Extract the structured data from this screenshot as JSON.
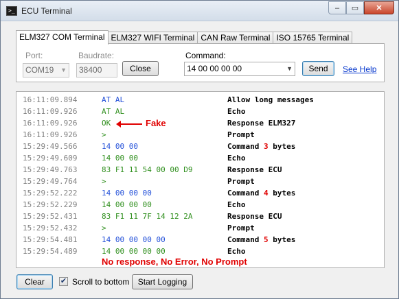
{
  "window": {
    "title": "ECU Terminal",
    "icon": "console-icon",
    "minimize_glyph": "–",
    "maximize_glyph": "▭",
    "close_glyph": "✕"
  },
  "tabs": [
    {
      "label": "ELM327 COM Terminal",
      "active": true
    },
    {
      "label": "ELM327 WIFI Terminal",
      "active": false
    },
    {
      "label": "CAN Raw Terminal",
      "active": false
    },
    {
      "label": "ISO 15765 Terminal",
      "active": false
    }
  ],
  "connection": {
    "port_label": "Port:",
    "port_value": "COM19",
    "baud_label": "Baudrate:",
    "baud_value": "38400",
    "close_button": "Close"
  },
  "command": {
    "label": "Command:",
    "value": "14 00 00 00 00",
    "send_button": "Send",
    "help_link": "See Help"
  },
  "log": {
    "rows": [
      {
        "time": "16:11:09.894",
        "message": "AT AL",
        "message_color": "blue",
        "description": "Allow long messages"
      },
      {
        "time": "16:11:09.926",
        "message": "AT AL",
        "message_color": "green",
        "description": "Echo"
      },
      {
        "time": "16:11:09.926",
        "message": "OK",
        "message_color": "green",
        "description": "Response ELM327"
      },
      {
        "time": "16:11:09.926",
        "message": ">",
        "message_color": "green",
        "description": "Prompt"
      },
      {
        "time": "15:29:49.566",
        "message": "14 00 00",
        "message_color": "blue",
        "description_pre": "Command ",
        "description_num": "3",
        "description_post": " bytes"
      },
      {
        "time": "15:29:49.609",
        "message": "14 00 00",
        "message_color": "green",
        "description": "Echo"
      },
      {
        "time": "15:29:49.763",
        "message": "83 F1 11 54 00 00 D9",
        "message_color": "green",
        "description": "Response ECU"
      },
      {
        "time": "15:29:49.764",
        "message": ">",
        "message_color": "green",
        "description": "Prompt"
      },
      {
        "time": "15:29:52.222",
        "message": "14 00 00 00",
        "message_color": "blue",
        "description_pre": "Command ",
        "description_num": "4",
        "description_post": " bytes"
      },
      {
        "time": "15:29:52.229",
        "message": "14 00 00 00",
        "message_color": "green",
        "description": "Echo"
      },
      {
        "time": "15:29:52.431",
        "message": "83 F1 11 7F 14 12 2A",
        "message_color": "green",
        "description": "Response ECU"
      },
      {
        "time": "15:29:52.432",
        "message": ">",
        "message_color": "green",
        "description": "Prompt"
      },
      {
        "time": "15:29:54.481",
        "message": "14 00 00 00 00",
        "message_color": "blue",
        "description_pre": "Command ",
        "description_num": "5",
        "description_post": " bytes"
      },
      {
        "time": "15:29:54.489",
        "message": "14 00 00 00 00",
        "message_color": "green",
        "description": "Echo"
      }
    ],
    "fake_annotation": "Fake",
    "no_response_annotation": "No response, No Error, No Prompt"
  },
  "footer": {
    "clear_button": "Clear",
    "scroll_checkbox_checked": true,
    "scroll_label": "Scroll to bottom",
    "start_logging_button": "Start Logging"
  },
  "colors": {
    "command_blue": "#2350d9",
    "echo_green": "#2f8f1d",
    "annotation_red": "#e00000",
    "timestamp_gray": "#7f7f7f"
  }
}
